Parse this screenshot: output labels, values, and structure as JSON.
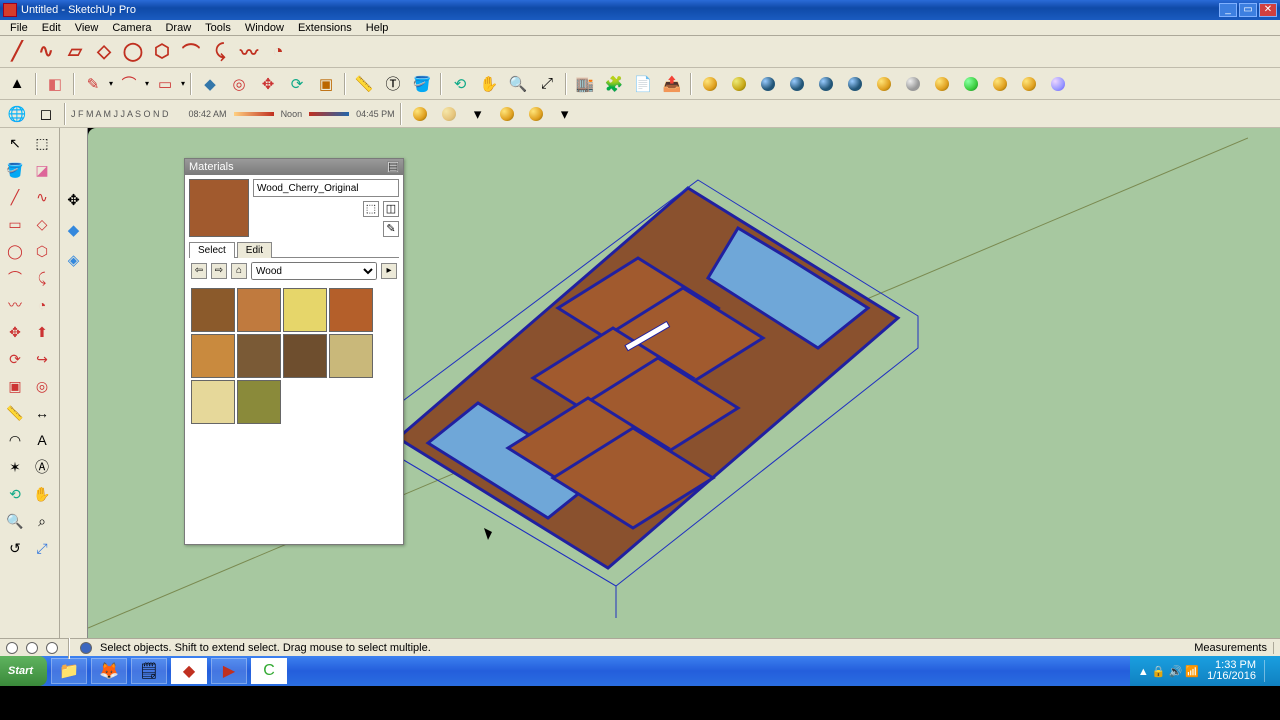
{
  "window": {
    "title": "Untitled - SketchUp Pro"
  },
  "menu": [
    "File",
    "Edit",
    "View",
    "Camera",
    "Draw",
    "Tools",
    "Window",
    "Extensions",
    "Help"
  ],
  "shadowbar": {
    "months": "J F M A M J J A S O N D",
    "t1": "08:42 AM",
    "noon": "Noon",
    "t2": "04:45 PM"
  },
  "materials": {
    "title": "Materials",
    "current_name": "Wood_Cherry_Original",
    "tabs": {
      "select": "Select",
      "edit": "Edit"
    },
    "category": "Wood",
    "swatches": [
      "#8b5a2b",
      "#c07a3e",
      "#e6d66a",
      "#b45f2a",
      "#c98a3e",
      "#7a5a36",
      "#6e4e2e",
      "#c9b87a",
      "#e6d89a",
      "#8a8a3a"
    ]
  },
  "status": {
    "hint": "Select objects. Shift to extend select. Drag mouse to select multiple.",
    "measurements_label": "Measurements"
  },
  "taskbar": {
    "start": "Start",
    "time": "1:33 PM",
    "date": "1/16/2016"
  }
}
